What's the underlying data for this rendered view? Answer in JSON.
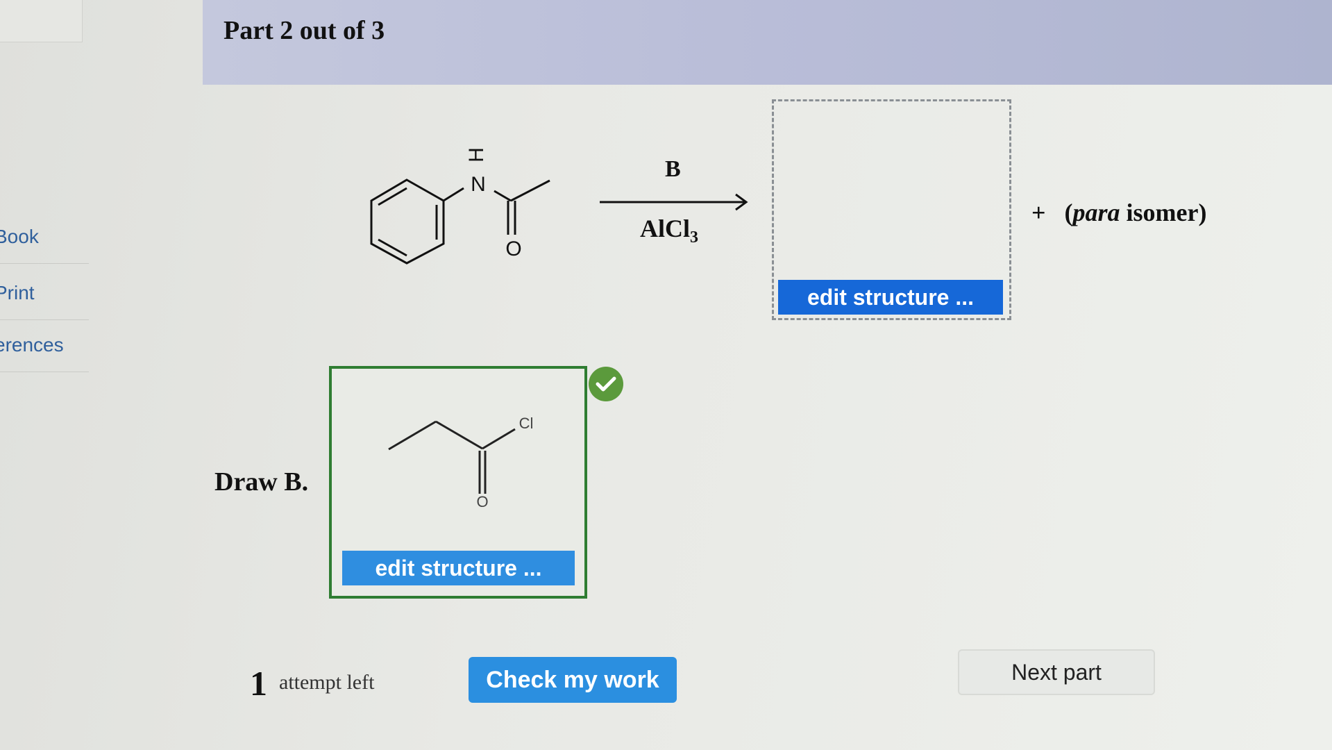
{
  "sidebar": {
    "items": [
      {
        "label": "Book"
      },
      {
        "label": "Print"
      },
      {
        "label": "erences"
      }
    ]
  },
  "header": {
    "title": "Part 2 out of 3"
  },
  "reaction": {
    "reactant_atoms": {
      "n": "N",
      "h": "H",
      "o": "O"
    },
    "reagent_top": "B",
    "reagent_bottom_main": "AlCl",
    "reagent_bottom_sub": "3",
    "answer_edit_label": "edit structure ...",
    "plus_sign": "+",
    "para_open": "(",
    "para_italic": "para",
    "para_rest": " isomer)"
  },
  "draw_b": {
    "label": "Draw B.",
    "atoms": {
      "cl": "Cl",
      "o": "O"
    },
    "edit_label": "edit structure ...",
    "status": "correct"
  },
  "footer": {
    "attempts_number": "1",
    "attempts_text": "attempt left",
    "check_label": "Check my work",
    "next_label": "Next part"
  },
  "colors": {
    "accent_blue": "#1668d8",
    "correct_green": "#2f7d32",
    "header_band": "#b9bdd8"
  }
}
